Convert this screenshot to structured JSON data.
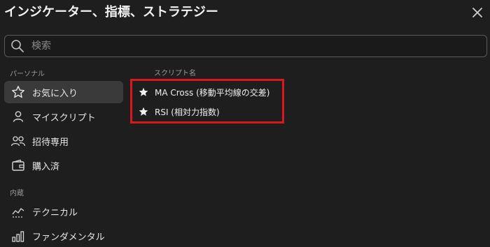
{
  "header": {
    "title": "インジケーター、指標、ストラテジー",
    "close_icon": "close-icon"
  },
  "search": {
    "placeholder": "検索",
    "value": "",
    "icon": "search-icon"
  },
  "sidebar": {
    "personal_label": "パーソナル",
    "builtin_label": "内蔵",
    "items": [
      {
        "label": "お気に入り",
        "icon": "star-outline-icon",
        "active": true
      },
      {
        "label": "マイスクリプト",
        "icon": "user-icon",
        "active": false
      },
      {
        "label": "招待専用",
        "icon": "users-icon",
        "active": false
      },
      {
        "label": "購入済",
        "icon": "wallet-icon",
        "active": false
      },
      {
        "label": "テクニカル",
        "icon": "chart-line-icon",
        "active": false
      },
      {
        "label": "ファンダメンタル",
        "icon": "bar-chart-icon",
        "active": false
      }
    ]
  },
  "main": {
    "column_header": "スクリプト名",
    "scripts": [
      {
        "name": "MA Cross (移動平均線の交差)",
        "icon": "star-filled-icon"
      },
      {
        "name": "RSI (相対力指数)",
        "icon": "star-filled-icon"
      }
    ]
  },
  "colors": {
    "background": "#1e1e1e",
    "active_item": "#3a3a3a",
    "highlight_border": "#d9181e",
    "text": "#e6e6e6",
    "muted_text": "#9a9a9a"
  }
}
